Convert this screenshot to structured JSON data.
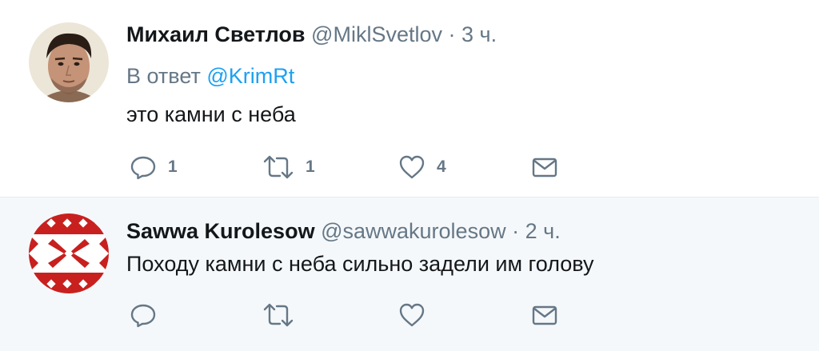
{
  "tweets": [
    {
      "author_name": "Михаил Светлов",
      "handle": "@MiklSvetlov",
      "separator": "·",
      "time": "3 ч.",
      "reply_prefix": "В ответ",
      "reply_mention": "@KrimRt",
      "text": "это камни с неба",
      "reply_count": "1",
      "retweet_count": "1",
      "like_count": "4",
      "icons": [
        "reply-icon",
        "retweet-icon",
        "like-icon",
        "direct-message-icon"
      ]
    },
    {
      "author_name": "Sawwa Kurolesow",
      "handle": "@sawwakurolesow",
      "separator": "·",
      "time": "2 ч.",
      "text": "Походу камни с неба сильно задели им голову",
      "icons": [
        "reply-icon",
        "retweet-icon",
        "like-icon",
        "direct-message-icon"
      ]
    }
  ],
  "colors": {
    "icon": "#657786",
    "link": "#1da1f2",
    "thread_line": "#b7d8f4",
    "reply_background": "#f5f8fa"
  }
}
